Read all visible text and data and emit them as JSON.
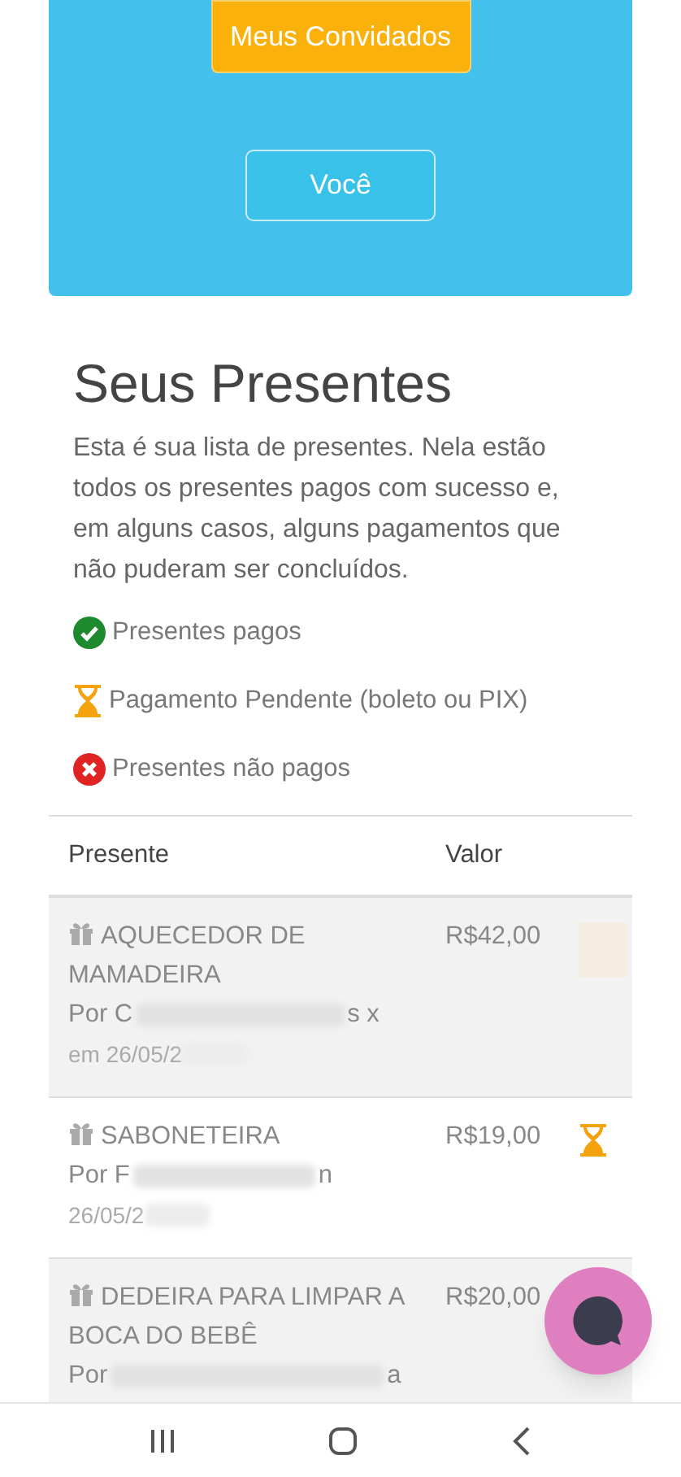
{
  "header": {
    "tab_label": "Meus Convidados",
    "button_label": "Você"
  },
  "title": "Seus Presentes",
  "intro": "Esta é sua lista de presentes. Nela estão todos os presentes pagos com sucesso e, em alguns casos, alguns pagamentos que não puderam ser concluídos.",
  "legend": [
    {
      "kind": "paid",
      "label": "Presentes pagos"
    },
    {
      "kind": "pending",
      "label": "Pagamento Pendente (boleto ou PIX)"
    },
    {
      "kind": "unpaid",
      "label": "Presentes não pagos"
    }
  ],
  "table": {
    "columns": [
      "Presente",
      "Valor"
    ],
    "rows": [
      {
        "name": "AQUECEDOR DE MAMADEIRA",
        "by_start": "Por C",
        "by_end": "s x",
        "date": "em 26/05/2",
        "price": "R$42,00",
        "kind": "faded"
      },
      {
        "name": "SABONETEIRA",
        "by_start": "Por F",
        "by_end": "n",
        "date": "26/05/2",
        "price": "R$19,00",
        "kind": "pending"
      },
      {
        "name": "DEDEIRA PARA LIMPAR A BOCA DO BEBÊ",
        "by_start": "Por",
        "by_end": "a",
        "price": "R$20,00"
      }
    ]
  }
}
